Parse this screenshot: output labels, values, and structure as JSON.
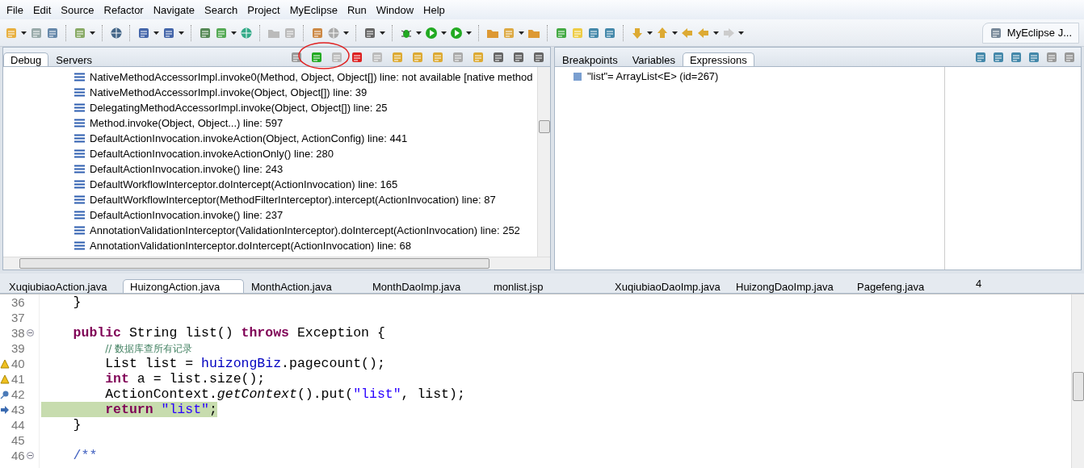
{
  "menu": [
    "File",
    "Edit",
    "Source",
    "Refactor",
    "Navigate",
    "Search",
    "Project",
    "MyEclipse",
    "Run",
    "Window",
    "Help"
  ],
  "perspective": {
    "label": "MyEclipse J..."
  },
  "debug_view": {
    "tabs": [
      {
        "label": "Debug",
        "selected": true
      },
      {
        "label": "Servers",
        "selected": false
      }
    ],
    "frames": [
      "NativeMethodAccessorImpl.invoke0(Method, Object, Object[]) line: not available [native method",
      "NativeMethodAccessorImpl.invoke(Object, Object[]) line: 39",
      "DelegatingMethodAccessorImpl.invoke(Object, Object[]) line: 25",
      "Method.invoke(Object, Object...) line: 597",
      "DefaultActionInvocation.invokeAction(Object, ActionConfig) line: 441",
      "DefaultActionInvocation.invokeActionOnly() line: 280",
      "DefaultActionInvocation.invoke() line: 243",
      "DefaultWorkflowInterceptor.doIntercept(ActionInvocation) line: 165",
      "DefaultWorkflowInterceptor(MethodFilterInterceptor).intercept(ActionInvocation) line: 87",
      "DefaultActionInvocation.invoke() line: 237",
      "AnnotationValidationInterceptor(ValidationInterceptor).doIntercept(ActionInvocation) line: 252",
      "AnnotationValidationInterceptor.doIntercept(ActionInvocation) line: 68"
    ]
  },
  "expressions_view": {
    "tabs": [
      {
        "label": "Breakpoints",
        "selected": false
      },
      {
        "label": "Variables",
        "selected": false
      },
      {
        "label": "Expressions",
        "selected": true
      }
    ],
    "rows": [
      "\"list\"= ArrayList<E>  (id=267)"
    ]
  },
  "editor": {
    "tabs": [
      {
        "label": "XuqiubiaoAction.java",
        "selected": false
      },
      {
        "label": "HuizongAction.java",
        "selected": true
      },
      {
        "label": "MonthAction.java",
        "selected": false
      },
      {
        "label": "MonthDaoImp.java",
        "selected": false
      },
      {
        "label": "monlist.jsp",
        "selected": false
      },
      {
        "label": "XuqiubiaoDaoImp.java",
        "selected": false
      },
      {
        "label": "HuizongDaoImp.java",
        "selected": false
      },
      {
        "label": "Pagefeng.java",
        "selected": false
      }
    ],
    "overflow_count": "4",
    "lines": [
      {
        "number": "36",
        "tokens": [
          {
            "kind": "plain",
            "text": "    }"
          }
        ]
      },
      {
        "number": "37"
      },
      {
        "number": "38",
        "fold": true,
        "tokens": [
          {
            "kind": "keyword",
            "text": "    public"
          },
          {
            "kind": "plain",
            "text": " String list() "
          },
          {
            "kind": "keyword",
            "text": "throws"
          },
          {
            "kind": "plain",
            "text": " Exception {"
          }
        ]
      },
      {
        "number": "39",
        "tokens": [
          {
            "kind": "comment",
            "text": "        // 数据库查所有记录"
          }
        ]
      },
      {
        "number": "40",
        "warning": true,
        "tokens": [
          {
            "kind": "plain",
            "text": "        List list = "
          },
          {
            "kind": "field",
            "text": "huizongBiz"
          },
          {
            "kind": "plain",
            "text": ".pagecount();"
          }
        ]
      },
      {
        "number": "41",
        "warning": true,
        "tokens": [
          {
            "kind": "keyword",
            "text": "        int"
          },
          {
            "kind": "plain",
            "text": " a = list.size();"
          }
        ]
      },
      {
        "number": "42",
        "breakpoint": true,
        "tokens": [
          {
            "kind": "plain",
            "text": "        ActionContext."
          },
          {
            "kind": "static",
            "text": "getContext"
          },
          {
            "kind": "plain",
            "text": "().put("
          },
          {
            "kind": "string",
            "text": "\"list\""
          },
          {
            "kind": "plain",
            "text": ", list);"
          }
        ]
      },
      {
        "number": "43",
        "highlighted": true,
        "current": true,
        "tokens": [
          {
            "kind": "keyword",
            "text": "        return"
          },
          {
            "kind": "string",
            "text": " \"list\""
          },
          {
            "kind": "plain",
            "text": ";"
          }
        ]
      },
      {
        "number": "44",
        "tokens": [
          {
            "kind": "plain",
            "text": "    }"
          }
        ]
      },
      {
        "number": "45"
      },
      {
        "number": "46",
        "fold": true,
        "tokens": [
          {
            "kind": "doc",
            "text": "    /**"
          }
        ]
      }
    ]
  }
}
